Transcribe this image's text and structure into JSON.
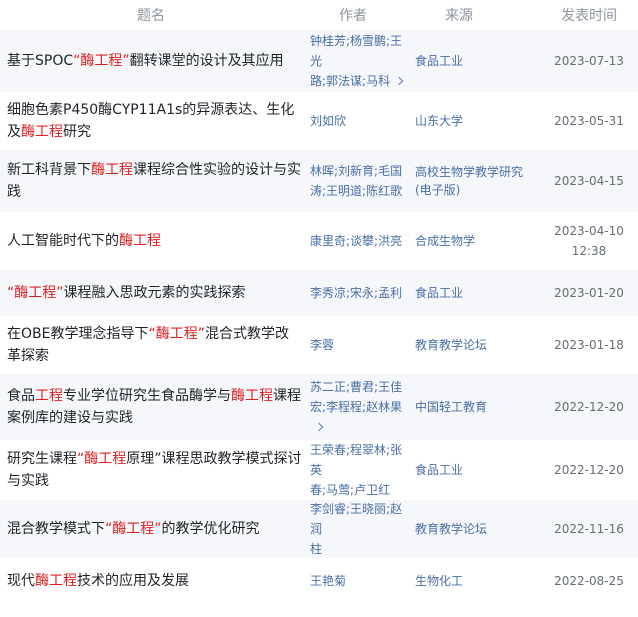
{
  "header": {
    "title": "题名",
    "author": "作者",
    "source": "来源",
    "date": "发表时间"
  },
  "rows": [
    {
      "title_parts": [
        [
          "基于SPOC",
          false
        ],
        [
          "“酶工程”",
          true
        ],
        [
          "翻转课堂的设计及其应用",
          false
        ]
      ],
      "author_lines": [
        "钟桂芳;杨雪鹏;王光",
        "路;郭法谋;马科"
      ],
      "author_more": true,
      "source_lines": [
        "食品工业"
      ],
      "date_lines": [
        "2023-07-13"
      ]
    },
    {
      "title_parts": [
        [
          "细胞色素P450酶CYP11A1s的异源表达、生化及",
          false
        ],
        [
          "酶工程",
          true
        ],
        [
          "研究",
          false
        ]
      ],
      "author_lines": [
        "刘如欣"
      ],
      "author_more": false,
      "source_lines": [
        "山东大学"
      ],
      "date_lines": [
        "2023-05-31"
      ]
    },
    {
      "title_parts": [
        [
          "新工科背景下",
          false
        ],
        [
          "酶工程",
          true
        ],
        [
          "课程综合性实验的设计与实践",
          false
        ]
      ],
      "author_lines": [
        "林晖;刘新育;毛国",
        "涛;王明道;陈红歌"
      ],
      "author_more": false,
      "source_lines": [
        "高校生物学教学研究",
        "(电子版)"
      ],
      "date_lines": [
        "2023-04-15"
      ]
    },
    {
      "title_parts": [
        [
          "人工智能时代下的",
          false
        ],
        [
          "酶工程",
          true
        ]
      ],
      "author_lines": [
        "康里奇;谈攀;洪亮"
      ],
      "author_more": false,
      "source_lines": [
        "合成生物学"
      ],
      "date_lines": [
        "2023-04-10",
        "12:38"
      ]
    },
    {
      "title_parts": [
        [
          "“酶工程”",
          true
        ],
        [
          "课程融入思政元素的实践探索",
          false
        ]
      ],
      "author_lines": [
        "李秀凉;宋永;孟利"
      ],
      "author_more": false,
      "source_lines": [
        "食品工业"
      ],
      "date_lines": [
        "2023-01-20"
      ]
    },
    {
      "title_parts": [
        [
          "在OBE教学理念指导下",
          false
        ],
        [
          "“酶工程”",
          true
        ],
        [
          "混合式教学改革探索",
          false
        ]
      ],
      "author_lines": [
        "李蓉"
      ],
      "author_more": false,
      "source_lines": [
        "教育教学论坛"
      ],
      "date_lines": [
        "2023-01-18"
      ]
    },
    {
      "title_parts": [
        [
          "食品",
          false
        ],
        [
          "工程",
          true
        ],
        [
          "专业学位研究生食品酶学与",
          false
        ],
        [
          "酶工程",
          true
        ],
        [
          "课程案例库的建设与实践",
          false
        ]
      ],
      "author_lines": [
        "苏二正;曹君;王佳",
        "宏;李程程;赵林果"
      ],
      "author_more": true,
      "source_lines": [
        "中国轻工教育"
      ],
      "date_lines": [
        "2022-12-20"
      ]
    },
    {
      "title_parts": [
        [
          "研究生课程",
          false
        ],
        [
          "“酶工程",
          true
        ],
        [
          "原理”",
          false
        ],
        [
          "课程思政教学模式探讨与实践",
          false
        ]
      ],
      "author_lines": [
        "王荣春;程翠林;张英",
        "春;马莺;卢卫红"
      ],
      "author_more": false,
      "source_lines": [
        "食品工业"
      ],
      "date_lines": [
        "2022-12-20"
      ]
    },
    {
      "title_parts": [
        [
          "混合教学模式下",
          false
        ],
        [
          "“酶工程”",
          true
        ],
        [
          "的教学优化研究",
          false
        ]
      ],
      "author_lines": [
        "李剑睿;王晓丽;赵润",
        "柱"
      ],
      "author_more": false,
      "source_lines": [
        "教育教学论坛"
      ],
      "date_lines": [
        "2022-11-16"
      ]
    },
    {
      "title_parts": [
        [
          "现代",
          false
        ],
        [
          "酶工程",
          true
        ],
        [
          "技术的应用及发展",
          false
        ]
      ],
      "author_lines": [
        "王艳菊"
      ],
      "author_more": false,
      "source_lines": [
        "生物化工"
      ],
      "date_lines": [
        "2022-08-25"
      ]
    }
  ]
}
